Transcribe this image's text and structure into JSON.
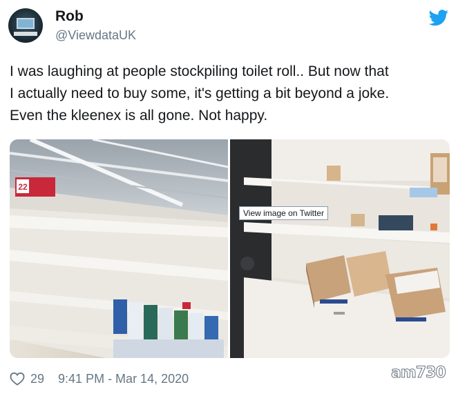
{
  "author": {
    "name": "Rob",
    "handle": "@ViewdataUK"
  },
  "icons": {
    "brand": "twitter-bird-icon",
    "like": "heart-icon",
    "brand_color": "#1da1f2"
  },
  "tweet": {
    "lines": [
      "I was laughing at people stockpiling toilet roll.. But now that",
      "I actually need to buy some, it's getting a bit beyond a joke.",
      "Even the kleenex is all gone. Not happy."
    ]
  },
  "media": {
    "tooltip": "View image on Twitter",
    "sign_number": "22"
  },
  "footer": {
    "likes": "29",
    "timestamp": "9:41 PM - Mar 14, 2020"
  },
  "watermark": "am730"
}
